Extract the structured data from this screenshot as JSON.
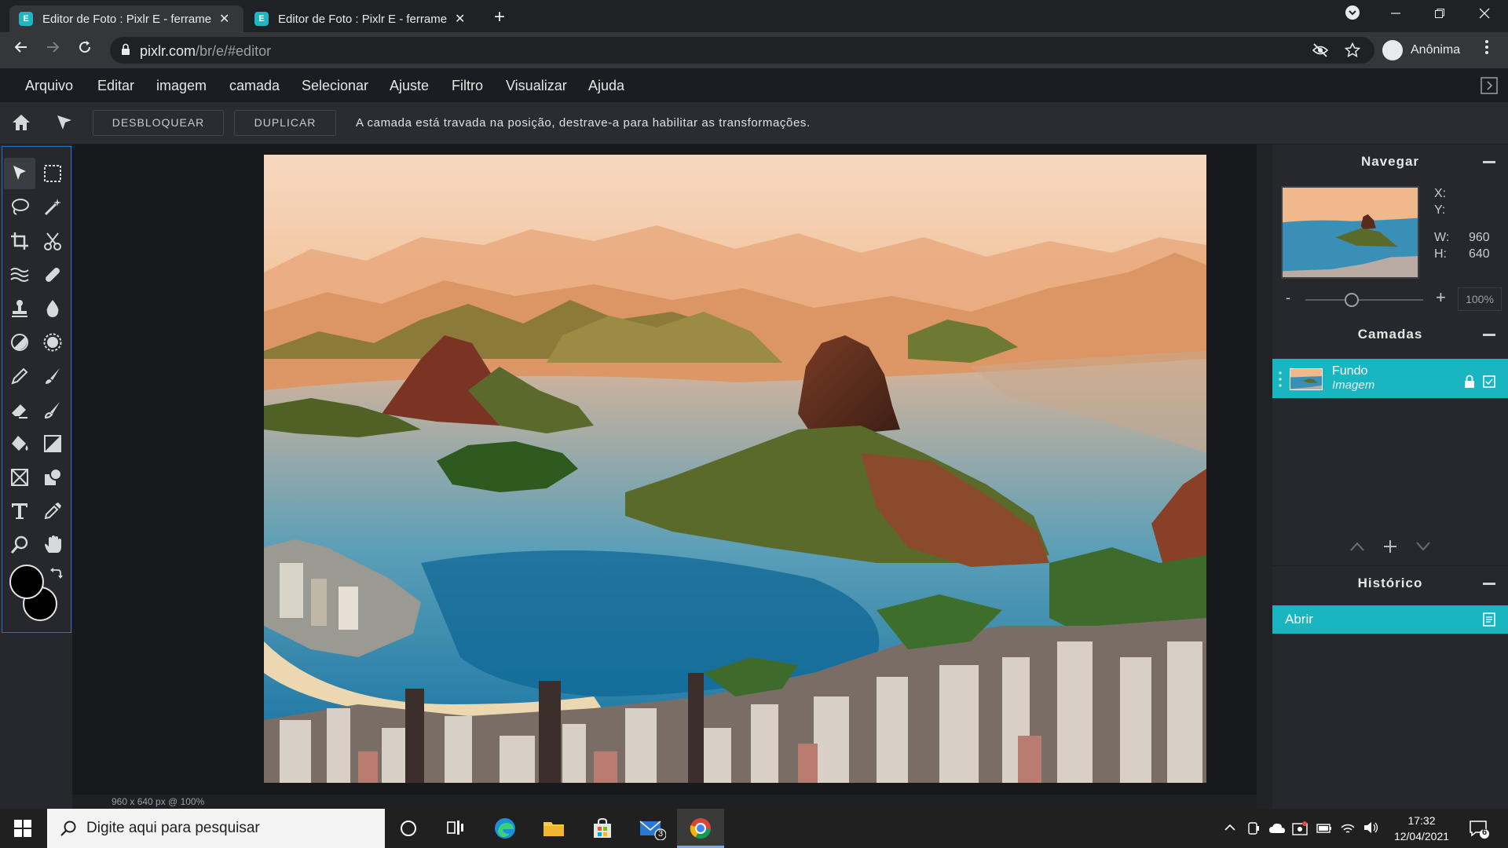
{
  "browser": {
    "tabs": [
      {
        "title": "Editor de Foto : Pixlr E - ferramenta",
        "close": "✕"
      },
      {
        "title": "Editor de Foto : Pixlr E - ferramenta",
        "close": "✕"
      }
    ],
    "new_tab": "+",
    "url_host": "pixlr.com",
    "url_path": "/br/e/#editor",
    "profile_label": "Anônima"
  },
  "app": {
    "menu": [
      "Arquivo",
      "Editar",
      "imagem",
      "camada",
      "Selecionar",
      "Ajuste",
      "Filtro",
      "Visualizar",
      "Ajuda"
    ],
    "toolbar": {
      "unlock_label": "DESBLOQUEAR",
      "duplicate_label": "DUPLICAR",
      "lock_message": "A camada está travada na posição, destrave-a para habilitar as transformações."
    },
    "status": "960 x 640 px @ 100%",
    "colors": {
      "accent": "#19b5c1",
      "foreground": "#000000",
      "background": "#000000"
    },
    "navigator": {
      "title": "Navegar",
      "x_label": "X:",
      "y_label": "Y:",
      "w_label": "W:",
      "w_value": "960",
      "h_label": "H:",
      "h_value": "640",
      "zoom_minus": "-",
      "zoom_plus": "+",
      "zoom_value": "100%"
    },
    "layers": {
      "title": "Camadas",
      "items": [
        {
          "name": "Fundo",
          "type": "Imagem"
        }
      ]
    },
    "history": {
      "title": "Histórico",
      "items": [
        "Abrir"
      ]
    }
  },
  "taskbar": {
    "search_placeholder": "Digite aqui para pesquisar",
    "mail_badge": "3",
    "time": "17:32",
    "date": "12/04/2021",
    "notification_count": "6"
  }
}
